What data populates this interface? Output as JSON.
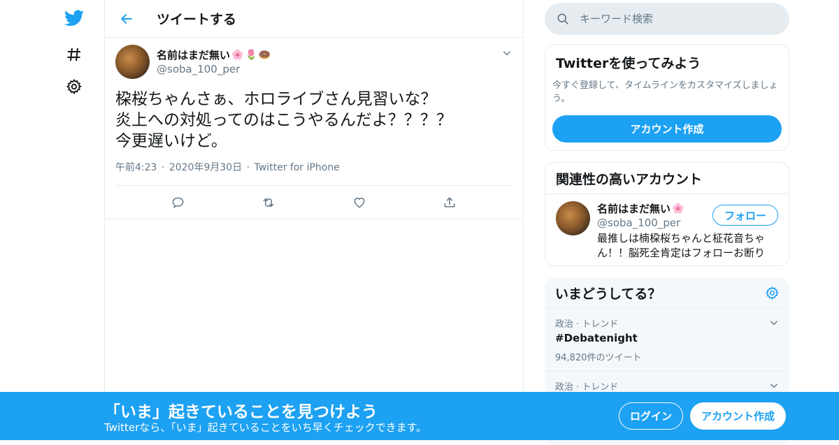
{
  "colors": {
    "accent": "#1da1f2",
    "text": "#14171a",
    "muted": "#657786",
    "border": "#e6ecf0"
  },
  "nav": {
    "icons": [
      "twitter-logo-icon",
      "hashtag-icon",
      "gear-icon"
    ]
  },
  "header": {
    "title": "ツイートする"
  },
  "tweet": {
    "display_name": "名前はまだ無い",
    "emojis": [
      "🌸",
      "🌷",
      "🍩"
    ],
    "handle": "@soba_100_per",
    "text": "桗桜ちゃんさぁ、ホロライブさん見習いな？\n炎上への対処ってのはこうやるんだよ？？？？\n今更遅いけど。",
    "time": "午前4:23",
    "date": "2020年9月30日",
    "source": "Twitter for iPhone",
    "sep": "·"
  },
  "search": {
    "placeholder": "キーワード検索"
  },
  "signup_card": {
    "title": "Twitterを使ってみよう",
    "desc": "今すぐ登録して、タイムラインをカスタマイズしましょう。",
    "button": "アカウント作成"
  },
  "related": {
    "title": "関連性の高いアカウント",
    "display_name": "名前はまだ無い",
    "emoji": "🌸",
    "handle": "@soba_100_per",
    "bio": "最推しは楠桗桜ちゃんと柾花音ちゃん！！脳死全肯定はフォローお断り",
    "follow": "フォロー"
  },
  "trends": {
    "title": "いまどうしてる？",
    "items": [
      {
        "category": "政治 · トレンド",
        "name": "#Debatenight",
        "count": "94,820件のツイート"
      },
      {
        "category": "政治 · トレンド",
        "name": "",
        "count": ""
      }
    ]
  },
  "bottom_bar": {
    "headline": "「いま」起きていることを見つけよう",
    "sub": "Twitterなら、「いま」起きていることをいち早くチェックできます。",
    "login": "ログイン",
    "signup": "アカウント作成"
  }
}
